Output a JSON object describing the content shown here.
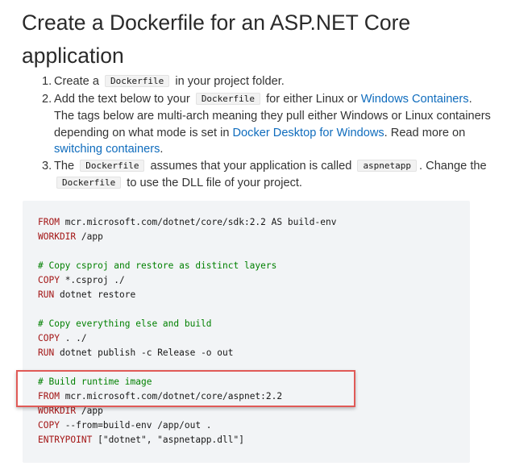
{
  "heading": "Create a Dockerfile for an ASP.NET Core application",
  "steps": [
    {
      "num": "1.",
      "t1": "Create a",
      "code1": "Dockerfile",
      "t2": "in your project folder."
    },
    {
      "num": "2.",
      "t1": "Add the text below to your",
      "code1": "Dockerfile",
      "t2": "for either Linux or",
      "link1": "Windows Containers",
      "t3": ". The tags below are multi-arch meaning they pull either Windows or Linux containers depending on what mode is set in",
      "link2": "Docker Desktop for Windows",
      "t4": ". Read more on",
      "link3": "switching containers",
      "t5": "."
    },
    {
      "num": "3.",
      "t1": "The",
      "code1": "Dockerfile",
      "t2": "assumes that your application is called",
      "code2": "aspnetapp",
      "t3": ". Change the",
      "code3": "Dockerfile",
      "t4": "to use the DLL file of your project."
    }
  ],
  "code_lines": [
    {
      "kw": "FROM",
      "rest": " mcr.microsoft.com/dotnet/core/sdk:2.2 AS build-env"
    },
    {
      "kw": "WORKDIR",
      "rest": " /app"
    },
    {
      "kw": "",
      "rest": ""
    },
    {
      "cm": "# Copy csproj and restore as distinct layers"
    },
    {
      "kw": "COPY",
      "rest": " *.csproj ./"
    },
    {
      "kw": "RUN",
      "rest": " dotnet restore"
    },
    {
      "kw": "",
      "rest": ""
    },
    {
      "cm": "# Copy everything else and build"
    },
    {
      "kw": "COPY",
      "rest": " . ./"
    },
    {
      "kw": "RUN",
      "rest": " dotnet publish -c Release -o out"
    },
    {
      "kw": "",
      "rest": ""
    },
    {
      "cm": "# Build runtime image"
    },
    {
      "kw": "FROM",
      "rest": " mcr.microsoft.com/dotnet/core/aspnet:2.2"
    },
    {
      "kw": "WORKDIR",
      "rest": " /app"
    },
    {
      "kw": "COPY",
      "rest": " --from=build-env /app/out ."
    },
    {
      "kw": "ENTRYPOINT",
      "rest": " [\"dotnet\", \"aspnetapp.dll\"]"
    }
  ],
  "colors": {
    "link": "#0f6cbd",
    "keyword": "#a31515",
    "comment": "#008000",
    "highlight_border": "#e05a57",
    "code_background": "#f2f4f6"
  }
}
